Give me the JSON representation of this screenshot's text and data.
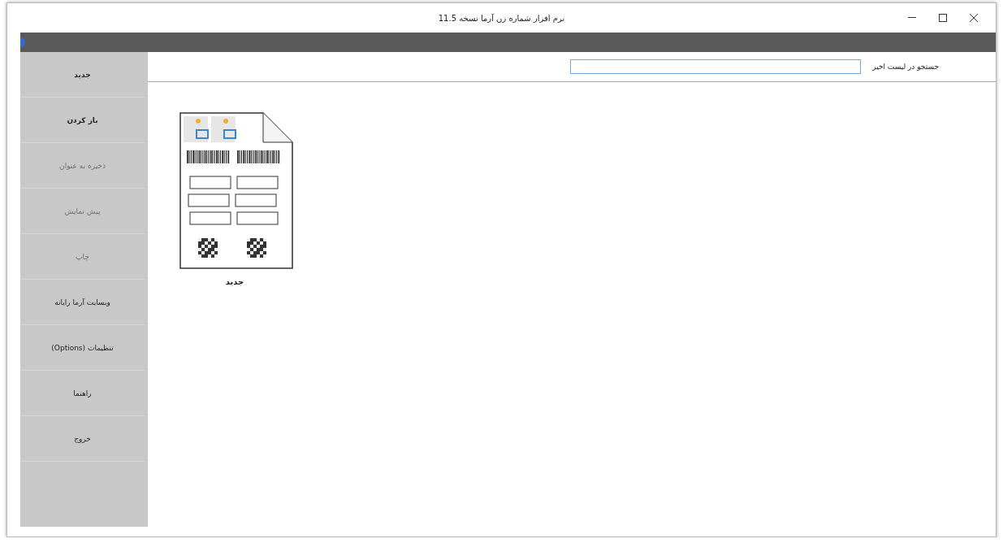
{
  "window": {
    "title": "نرم افزار شماره زن آرما نسخه 11.5"
  },
  "search": {
    "label": "جستجو در لیست اخیر"
  },
  "sidebar": {
    "items": [
      {
        "label": "جدید",
        "disabled": false,
        "bold": true
      },
      {
        "label": "باز کردن",
        "disabled": false,
        "bold": true
      },
      {
        "label": "ذخیره به عنوان",
        "disabled": true,
        "bold": false
      },
      {
        "label": "پیش نمایش",
        "disabled": true,
        "bold": false
      },
      {
        "label": "چاپ",
        "disabled": true,
        "bold": false
      },
      {
        "label": "وبسایت آرما رایانه",
        "disabled": false,
        "bold": false
      },
      {
        "label": "تنظیمات (Options)",
        "disabled": false,
        "bold": false
      },
      {
        "label": "راهنما",
        "disabled": false,
        "bold": false
      },
      {
        "label": "خروج",
        "disabled": false,
        "bold": false
      }
    ]
  },
  "recent": [
    {
      "label": "جدید"
    }
  ]
}
